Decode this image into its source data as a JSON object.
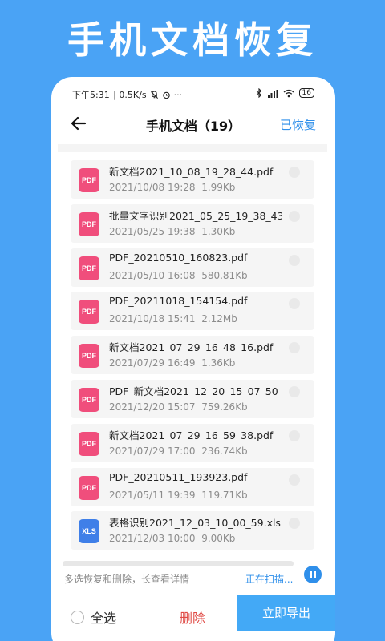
{
  "banner": {
    "title": "手机文档恢复"
  },
  "status_bar": {
    "time": "下午5:31",
    "speed": "0.5K/s",
    "battery": "16"
  },
  "app_bar": {
    "title": "手机文档（19）",
    "recovered_label": "已恢复"
  },
  "files": [
    {
      "type": "PDF",
      "name": "新文档2021_10_08_19_28_44.pdf",
      "date": "2021/10/08 19:28",
      "size": "1.99Kb"
    },
    {
      "type": "PDF",
      "name": "批量文字识别2021_05_25_19_38_43....",
      "date": "2021/05/25 19:38",
      "size": "1.30Kb"
    },
    {
      "type": "PDF",
      "name": "PDF_20210510_160823.pdf",
      "date": "2021/05/10 16:08",
      "size": "580.81Kb"
    },
    {
      "type": "PDF",
      "name": "PDF_20211018_154154.pdf",
      "date": "2021/10/18 15:41",
      "size": "2.12Mb"
    },
    {
      "type": "PDF",
      "name": "新文档2021_07_29_16_48_16.pdf",
      "date": "2021/07/29 16:49",
      "size": "1.36Kb"
    },
    {
      "type": "PDF",
      "name": "PDF_新文档2021_12_20_15_07_50_2...",
      "date": "2021/12/20 15:07",
      "size": "759.26Kb"
    },
    {
      "type": "PDF",
      "name": "新文档2021_07_29_16_59_38.pdf",
      "date": "2021/07/29 17:00",
      "size": "236.74Kb"
    },
    {
      "type": "PDF",
      "name": "PDF_20210511_193923.pdf",
      "date": "2021/05/11 19:39",
      "size": "119.71Kb"
    },
    {
      "type": "XLS",
      "name": "表格识别2021_12_03_10_00_59.xls",
      "date": "2021/12/03 10:00",
      "size": "9.00Kb"
    }
  ],
  "footer": {
    "hint": "多选恢复和删除，长查看详情",
    "scanning": "正在扫描...",
    "select_all": "全选",
    "delete": "删除",
    "export": "立即导出"
  },
  "colors": {
    "background": "#4aa3f5",
    "accent": "#2f8fea",
    "pdf_icon": "#f04e7c",
    "xls_icon": "#3f7fe8",
    "delete": "#e04a45"
  },
  "icons": [
    "back-arrow-icon",
    "silent-bell-icon",
    "alarm-icon",
    "bluetooth-icon",
    "signal-icon",
    "wifi-icon",
    "battery-icon",
    "pause-icon"
  ]
}
